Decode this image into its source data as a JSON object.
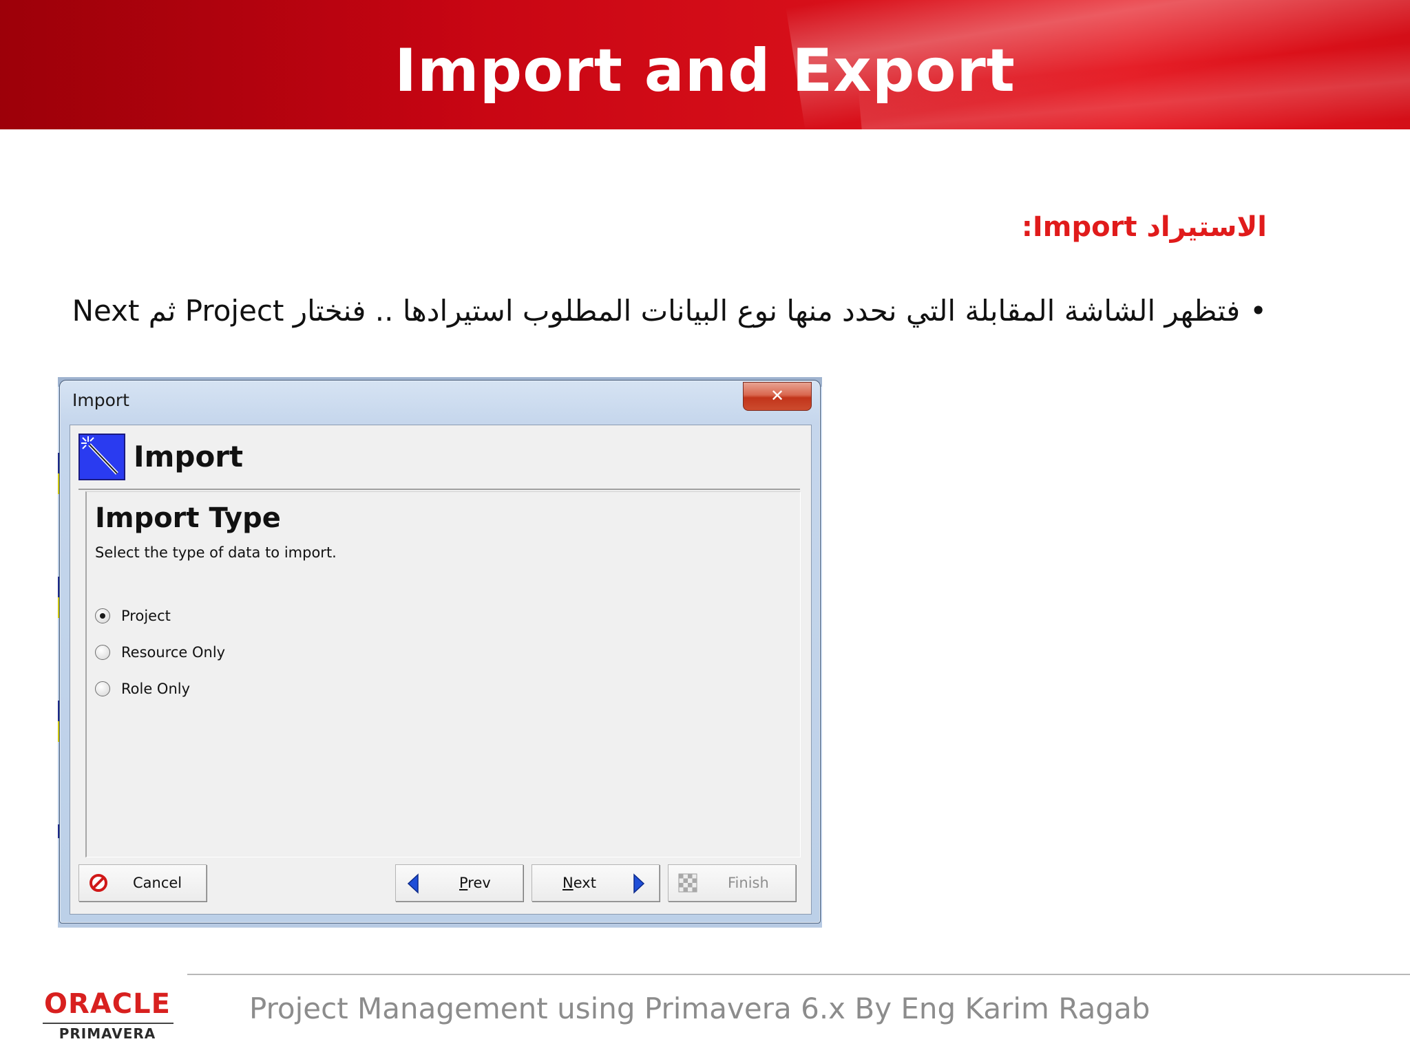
{
  "slide": {
    "title": "Import and Export",
    "heading": "الاستيراد Import:",
    "bullet": "فتظهر الشاشة المقابلة التي نحدد منها نوع البيانات المطلوب استيرادها .. فنختار  Project ثم Next",
    "footer": "Project Management using Primavera 6.x By Eng Karim Ragab",
    "logo": {
      "brand": "ORACLE",
      "product": "PRIMAVERA"
    }
  },
  "dialog": {
    "window_title": "Import",
    "close_glyph": "✕",
    "header_title": "Import",
    "section_title": "Import Type",
    "instruction": "Select the type of data to import.",
    "options": [
      {
        "label": "Project",
        "selected": true
      },
      {
        "label": "Resource Only",
        "selected": false
      },
      {
        "label": "Role Only",
        "selected": false
      }
    ],
    "buttons": {
      "cancel": "Cancel",
      "prev_mnemonic": "P",
      "prev_rest": "rev",
      "next_mnemonic": "N",
      "next_rest": "ext",
      "finish": "Finish"
    }
  },
  "colors": {
    "banner_red": "#d8101a",
    "heading_red": "#e01b1b",
    "wizard_icon_blue": "#2a3bf0",
    "arrow_blue": "#1f4fd8",
    "oracle_red": "#d8201f"
  }
}
